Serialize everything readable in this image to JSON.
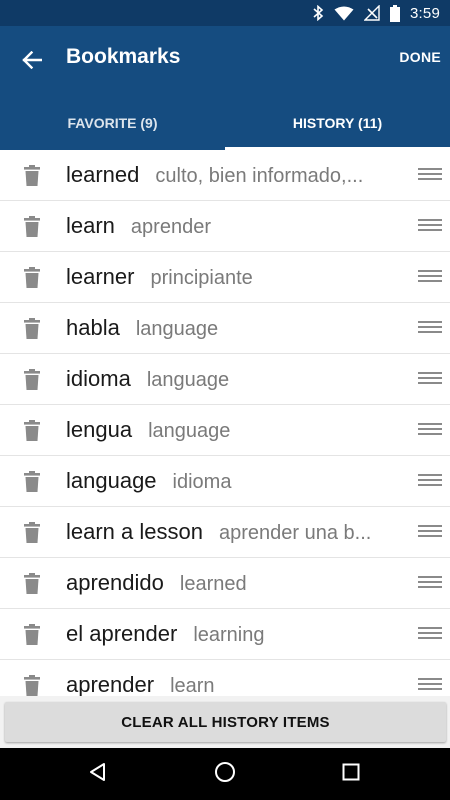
{
  "status_bar": {
    "time": "3:59",
    "icons": [
      "bluetooth-icon",
      "wifi-icon",
      "no-signal-icon",
      "battery-icon"
    ]
  },
  "app_bar": {
    "title": "Bookmarks",
    "done_label": "DONE",
    "back_icon": "arrow-left-icon",
    "accent_color": "#154c80"
  },
  "tabs": [
    {
      "label": "FAVORITE (9)",
      "active": false
    },
    {
      "label": "HISTORY (11)",
      "active": true
    }
  ],
  "history_items": [
    {
      "word": "learned",
      "translation": "culto, bien informado,..."
    },
    {
      "word": "learn",
      "translation": "aprender"
    },
    {
      "word": "learner",
      "translation": "principiante"
    },
    {
      "word": "habla",
      "translation": "language"
    },
    {
      "word": "idioma",
      "translation": "language"
    },
    {
      "word": "lengua",
      "translation": "language"
    },
    {
      "word": "language",
      "translation": "idioma"
    },
    {
      "word": "learn a lesson",
      "translation": "aprender una b..."
    },
    {
      "word": "aprendido",
      "translation": "learned"
    },
    {
      "word": "el aprender",
      "translation": "learning"
    },
    {
      "word": "aprender",
      "translation": "learn"
    }
  ],
  "clear_button": {
    "label": "CLEAR ALL HISTORY ITEMS"
  },
  "nav_bar": {
    "icons": [
      "back-triangle-icon",
      "home-circle-icon",
      "recents-square-icon"
    ]
  }
}
